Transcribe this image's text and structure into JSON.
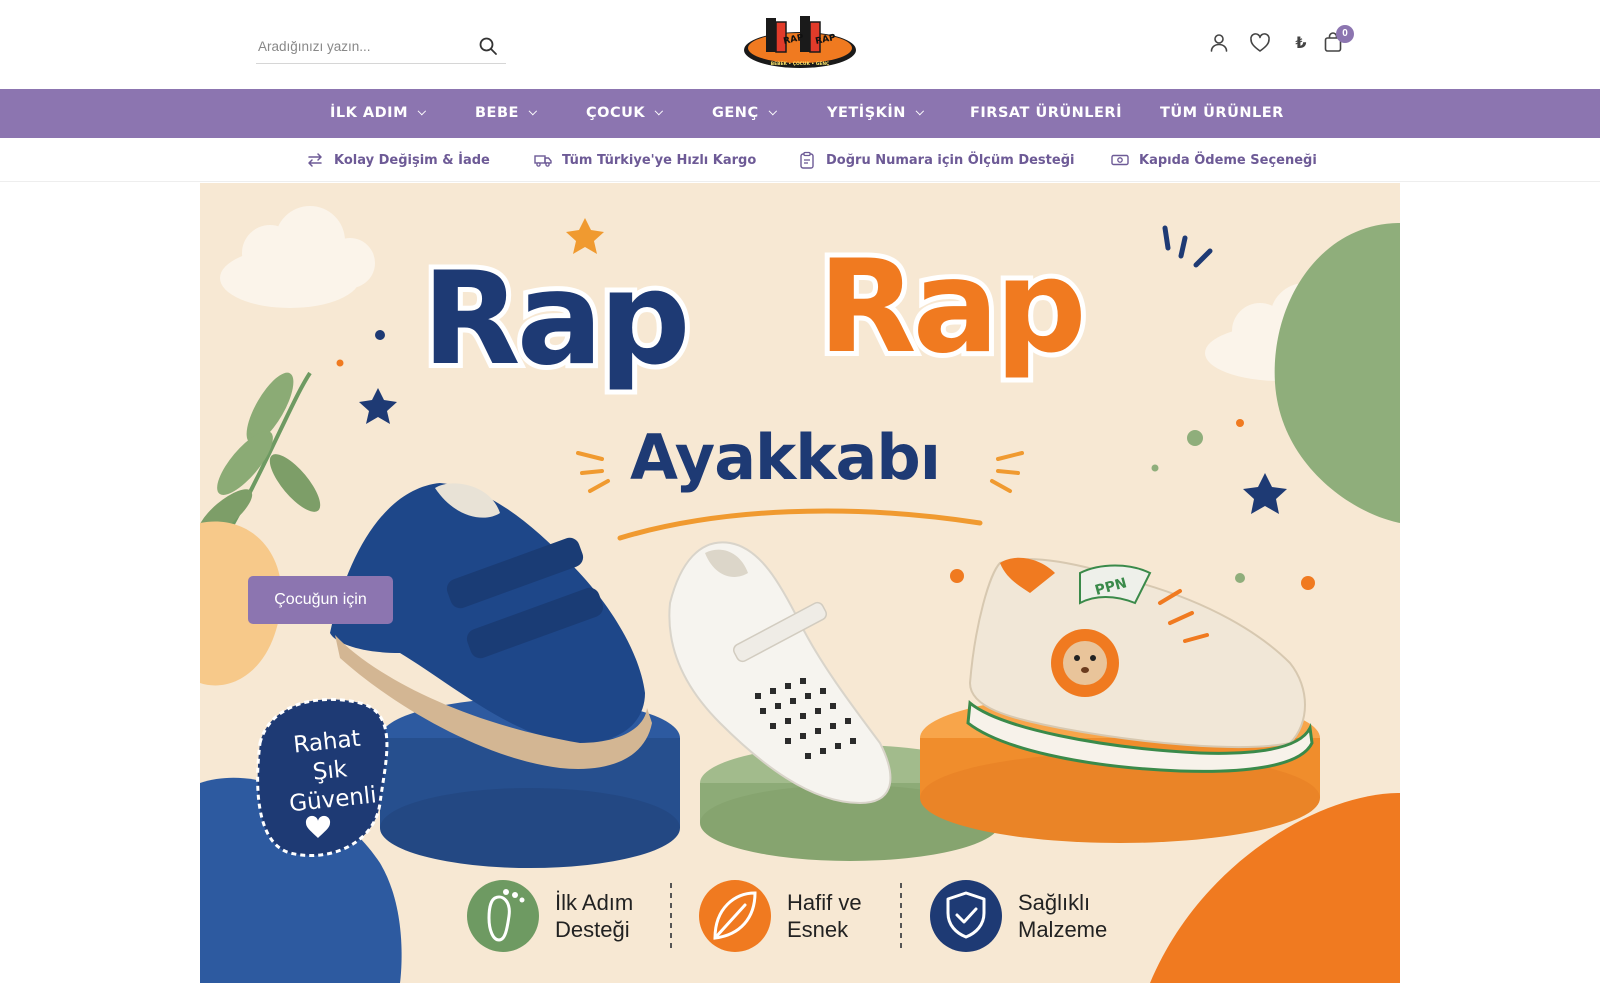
{
  "header": {
    "search": {
      "placeholder": "Aradığınızı yazın..."
    },
    "logo": {
      "text_top": "RAP",
      "text_top2": "RAP",
      "tagline": "BEBEK • ÇOCUK • GENÇ"
    },
    "cart_count": "0",
    "currency_symbol": "₺"
  },
  "nav": {
    "items": [
      {
        "label": "İLK ADIM",
        "has_dropdown": true
      },
      {
        "label": "BEBE",
        "has_dropdown": true
      },
      {
        "label": "ÇOCUK",
        "has_dropdown": true
      },
      {
        "label": "GENÇ",
        "has_dropdown": true
      },
      {
        "label": "YETİŞKİN",
        "has_dropdown": true
      },
      {
        "label": "FIRSAT ÜRÜNLERİ",
        "has_dropdown": false
      },
      {
        "label": "TÜM ÜRÜNLER",
        "has_dropdown": false
      }
    ]
  },
  "features": [
    {
      "icon": "swap-arrows-icon",
      "label": "Kolay Değişim & İade"
    },
    {
      "icon": "truck-icon",
      "label": "Tüm Türkiye'ye Hızlı Kargo"
    },
    {
      "icon": "clipboard-icon",
      "label": "Doğru Numara için Ölçüm Desteği"
    },
    {
      "icon": "cash-icon",
      "label": "Kapıda Ödeme Seçeneği"
    }
  ],
  "hero": {
    "brand_word1": "Rap",
    "brand_word2": "Rap",
    "brand_sub": "Ayakkabı",
    "cta_label": "Çocuğun için",
    "badge_lines": [
      "Rahat",
      "Şık",
      "Güvenli"
    ],
    "benefits": [
      {
        "icon": "footprint-icon",
        "lines": [
          "İlk Adım",
          "Desteği"
        ],
        "color": "#6e9a62"
      },
      {
        "icon": "leaf-icon",
        "lines": [
          "Hafif ve",
          "Esnek"
        ],
        "color": "#f07a20"
      },
      {
        "icon": "shield-check-icon",
        "lines": [
          "Sağlıklı",
          "Malzeme"
        ],
        "color": "#1e3a74"
      }
    ]
  },
  "colors": {
    "primary": "#8c75b0",
    "navy": "#1e3a74",
    "orange": "#f07a20",
    "green": "#6e9a62",
    "hero_bg": "#f7e8d3"
  }
}
